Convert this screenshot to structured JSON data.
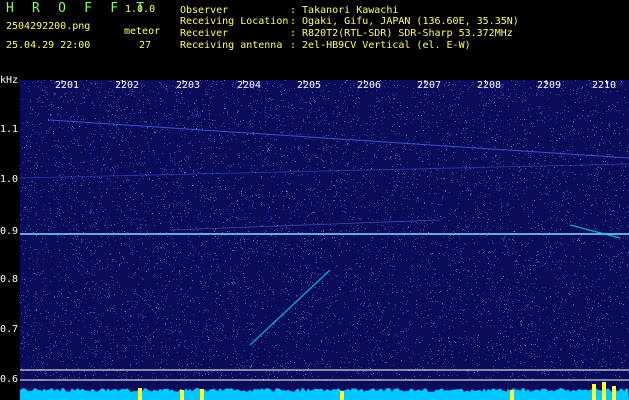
{
  "header": {
    "app_title": "H R O F F T",
    "version": "1.0.0",
    "file_name": "2504292200.png",
    "datetime": "25.04.29 22:00",
    "meteor_label": "meteor",
    "meteor_count": "27"
  },
  "info": {
    "observer_label": "Observer",
    "observer_value": ": Takanori Kawachi",
    "location_label": "Receiving Location",
    "location_value": ": Ogaki, Gifu, JAPAN (136.60E, 35.35N)",
    "receiver_label": "Receiver",
    "receiver_value": ": R820T2(RTL-SDR) SDR-Sharp 53.372MHz",
    "antenna_label": "Receiving antenna",
    "antenna_value": ": 2el-HB9CV Vertical (el. E-W)"
  },
  "axis": {
    "unit": "kHz",
    "hours": [
      "2201",
      "2202",
      "2203",
      "2204",
      "2205",
      "2206",
      "2207",
      "2208",
      "2209",
      "2210"
    ],
    "freqs": [
      "1.1",
      "1.0",
      "0.9",
      "0.8",
      "0.7",
      "0.6"
    ]
  },
  "colors": {
    "background": "#0a0c5a",
    "header_green": "#7cff6a",
    "header_yellow": "#ffff66",
    "carrier_line": "#7fdfff",
    "meteor_trace": "#00d4ff",
    "power_trace": "#00c8ff",
    "power_peak": "#ffff33"
  }
}
